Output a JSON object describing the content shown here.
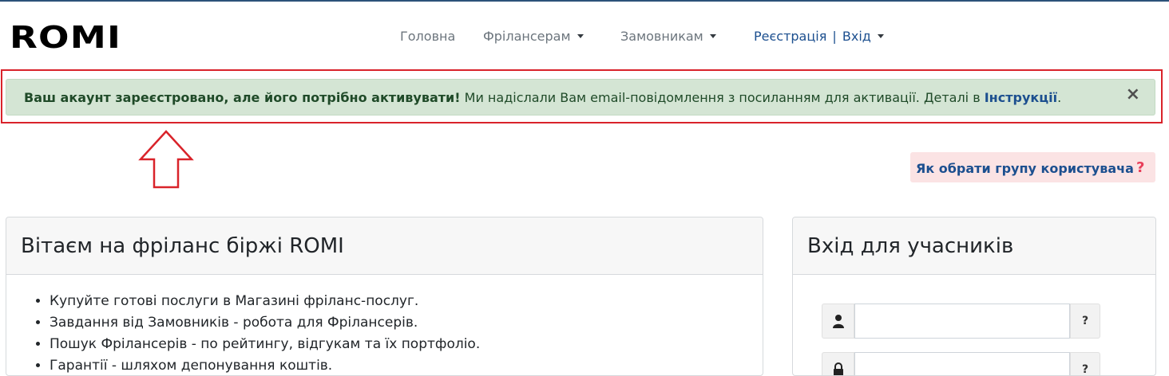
{
  "brand": {
    "logo_text": "ROMI"
  },
  "nav": {
    "home": "Головна",
    "freelancers": "Фрілансерам",
    "clients": "Замовникам",
    "register": "Реєстрація",
    "separator": "|",
    "login": "Вхід"
  },
  "alert": {
    "bold": "Ваш акаунт зареєстровано, але його потрібно активувати!",
    "message": " Ми надіслали Вам email-повідомлення з посиланням для активації. Деталі в ",
    "link": "Інструкції",
    "tail": ".",
    "close": "×"
  },
  "help": {
    "label": "Як обрати групу користувача",
    "icon": "?"
  },
  "welcome": {
    "title": "Вітаєм на фріланс біржі ROMI",
    "items": [
      "Купуйте готові послуги в Магазині фріланс-послуг.",
      "Завдання від Замовників - робота для Фрілансерів.",
      "Пошук Фрілансерів - по рейтингу, відгукам та їх портфоліо.",
      "Гарантії - шляхом депонування коштів."
    ]
  },
  "login": {
    "title": "Вхід для учасників",
    "username_help": "?",
    "password_help": "?"
  },
  "colors": {
    "accent": "#1c4f8f",
    "alert_bg": "#d4e5d4",
    "highlight": "#d9232a",
    "help_bg": "#fbe3e4"
  }
}
